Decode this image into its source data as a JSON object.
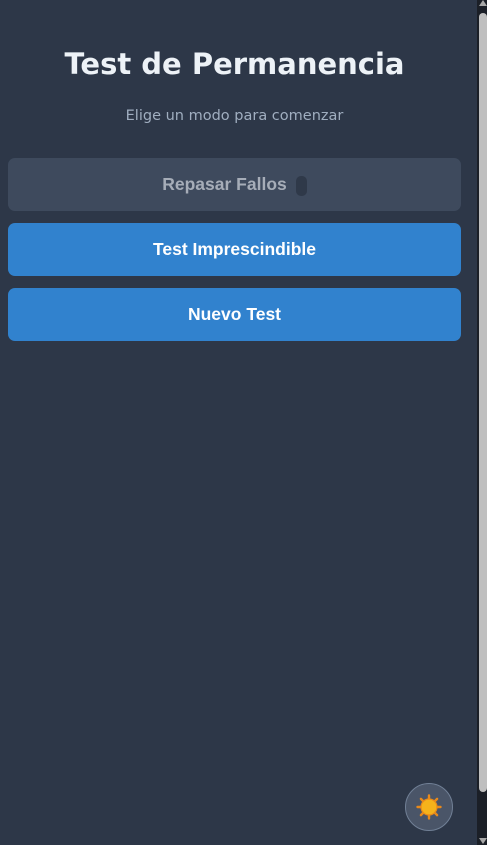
{
  "header": {
    "title": "Test de Permanencia",
    "subtitle": "Elige un modo para comenzar"
  },
  "modes": [
    {
      "label": "Repasar Fallos",
      "enabled": false
    },
    {
      "label": "Test Imprescindible",
      "enabled": true
    },
    {
      "label": "Nuevo Test",
      "enabled": true
    }
  ],
  "theme_toggle": {
    "icon": "sun-icon"
  },
  "colors": {
    "background": "#2d3748",
    "primary_button": "#3182ce",
    "disabled_button": "#3e4a5d",
    "title": "#edf2f7",
    "subtitle": "#a0aec0"
  }
}
